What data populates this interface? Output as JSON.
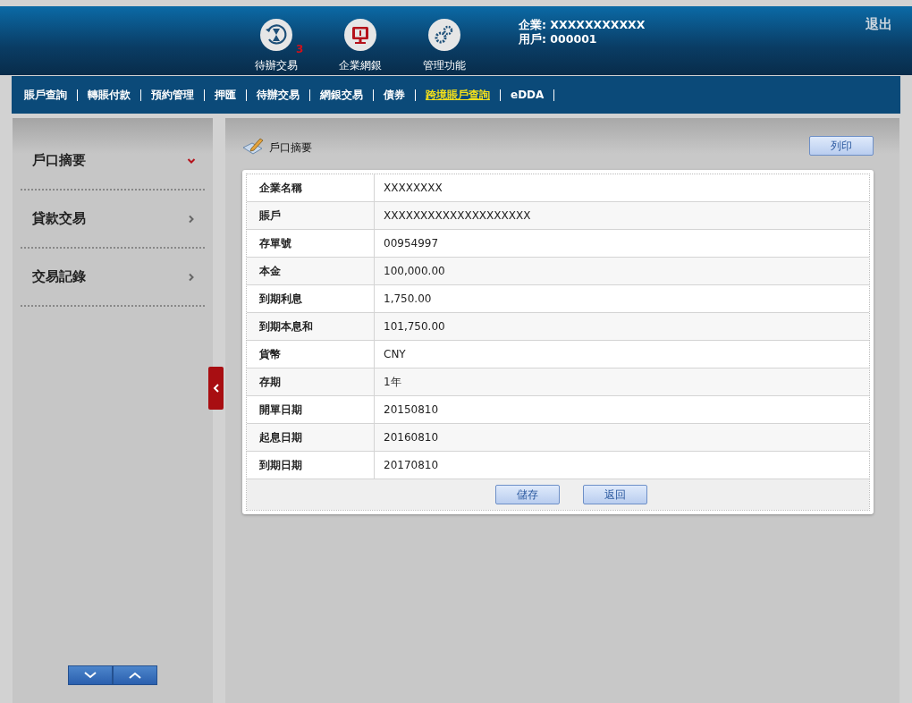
{
  "header": {
    "apps": [
      {
        "kind": "pending",
        "label": "待辦交易",
        "badge": "3"
      },
      {
        "kind": "bank",
        "label": "企業網銀"
      },
      {
        "kind": "admin",
        "label": "管理功能"
      }
    ],
    "company": "企業: XXXXXXXXXXX",
    "user": "用戶: 000001",
    "logout": "退出"
  },
  "nav": [
    {
      "label": "賬戶查詢",
      "selected": false
    },
    {
      "label": "轉賬付款",
      "selected": false
    },
    {
      "label": "預約管理",
      "selected": false
    },
    {
      "label": "押匯",
      "selected": false
    },
    {
      "label": "待辦交易",
      "selected": false
    },
    {
      "label": "網銀交易",
      "selected": false
    },
    {
      "label": "債券",
      "selected": false
    },
    {
      "label": "跨境賬戶查詢",
      "selected": true
    },
    {
      "label": "eDDA",
      "selected": false
    }
  ],
  "sidebar": {
    "items": [
      {
        "label": "戶口摘要",
        "expanded": true
      },
      {
        "label": "貸款交易",
        "expanded": false
      },
      {
        "label": "交易記錄",
        "expanded": false
      }
    ]
  },
  "main": {
    "title": "戶口摘要",
    "print_button": "列印",
    "rows": [
      {
        "label": "企業名稱",
        "value": "XXXXXXXX"
      },
      {
        "label": "賬戶",
        "value": "XXXXXXXXXXXXXXXXXXXX"
      },
      {
        "label": "存單號",
        "value": "00954997"
      },
      {
        "label": "本金",
        "value": "100,000.00"
      },
      {
        "label": "到期利息",
        "value": "1,750.00"
      },
      {
        "label": "到期本息和",
        "value": "101,750.00"
      },
      {
        "label": "貨幣",
        "value": "CNY"
      },
      {
        "label": "存期",
        "value": "1年"
      },
      {
        "label": "開單日期",
        "value": "20150810"
      },
      {
        "label": "起息日期",
        "value": "20160810"
      },
      {
        "label": "到期日期",
        "value": "20170810"
      }
    ],
    "buttons": [
      "儲存",
      "返回"
    ]
  }
}
